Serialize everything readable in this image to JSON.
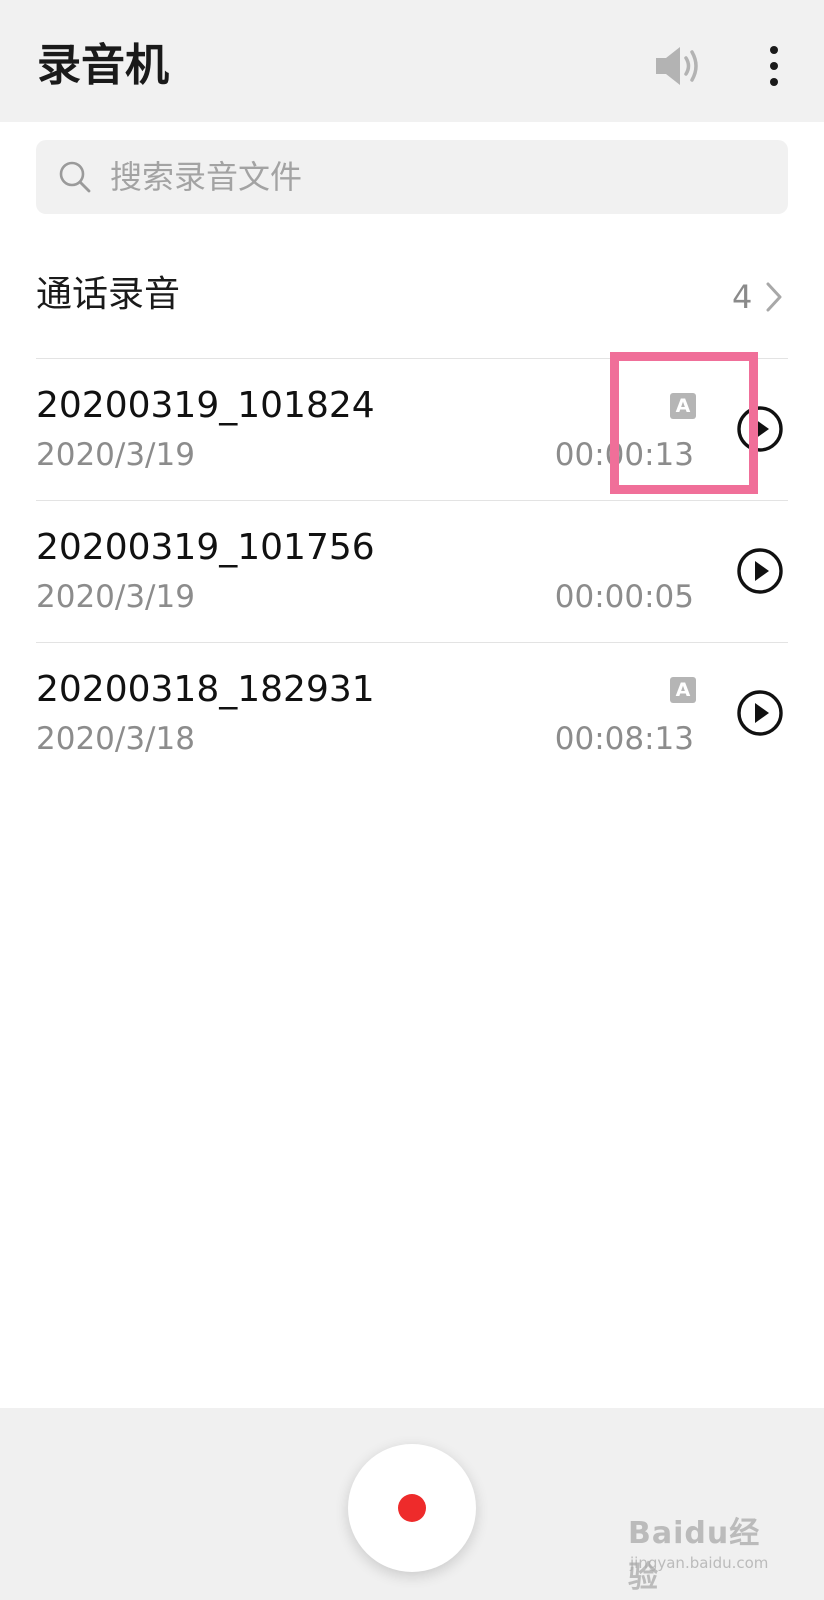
{
  "header": {
    "title": "录音机",
    "speaker_icon": "speaker-icon",
    "more_icon": "more-vertical-icon"
  },
  "search": {
    "placeholder": "搜索录音文件",
    "value": ""
  },
  "call_recordings": {
    "label": "通话录音",
    "count": "4"
  },
  "recordings": [
    {
      "name": "20200319_101824",
      "date": "2020/3/19",
      "duration": "00:00:13",
      "has_badge": true,
      "badge": "A"
    },
    {
      "name": "20200319_101756",
      "date": "2020/3/19",
      "duration": "00:00:05",
      "has_badge": false,
      "badge": ""
    },
    {
      "name": "20200318_182931",
      "date": "2020/3/18",
      "duration": "00:08:13",
      "has_badge": true,
      "badge": "A"
    }
  ],
  "watermark": {
    "logo": "Baidu经验",
    "url": "jingyan.baidu.com"
  },
  "colors": {
    "header_bg": "#f1f1f1",
    "record_red": "#ee2b2b",
    "highlight": "#f06f99",
    "secondary_text": "#8c8c8c"
  }
}
